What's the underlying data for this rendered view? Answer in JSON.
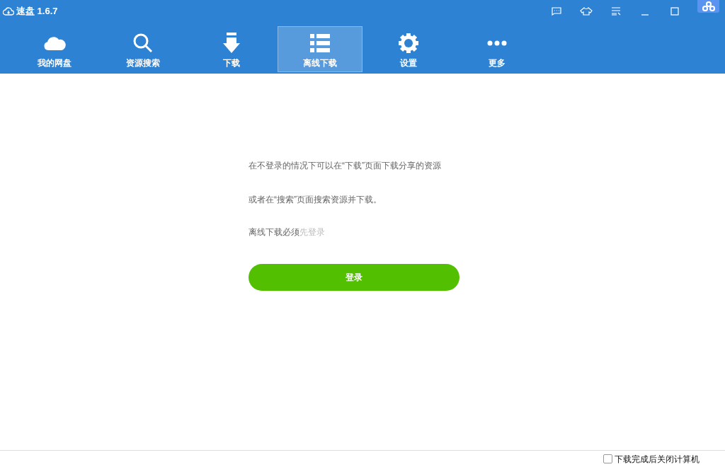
{
  "window": {
    "title": "速盘 1.6.7"
  },
  "nav": [
    {
      "label": "我的网盘",
      "selected": false
    },
    {
      "label": "资源搜索",
      "selected": false
    },
    {
      "label": "下载",
      "selected": false
    },
    {
      "label": "离线下载",
      "selected": true
    },
    {
      "label": "设置",
      "selected": false
    },
    {
      "label": "更多",
      "selected": false
    }
  ],
  "message": {
    "lines": [
      "在不登录的情况下可以在“下载”页面下载分享的资源",
      "或者在“搜索”页面搜索资源并下载。"
    ],
    "notice": "离线下载必须",
    "notice_link": "先登录"
  },
  "login_button": "登录",
  "status_bar": {
    "shutdown_checkbox": {
      "label": "下载完成后关闭计算机",
      "checked": false
    }
  }
}
